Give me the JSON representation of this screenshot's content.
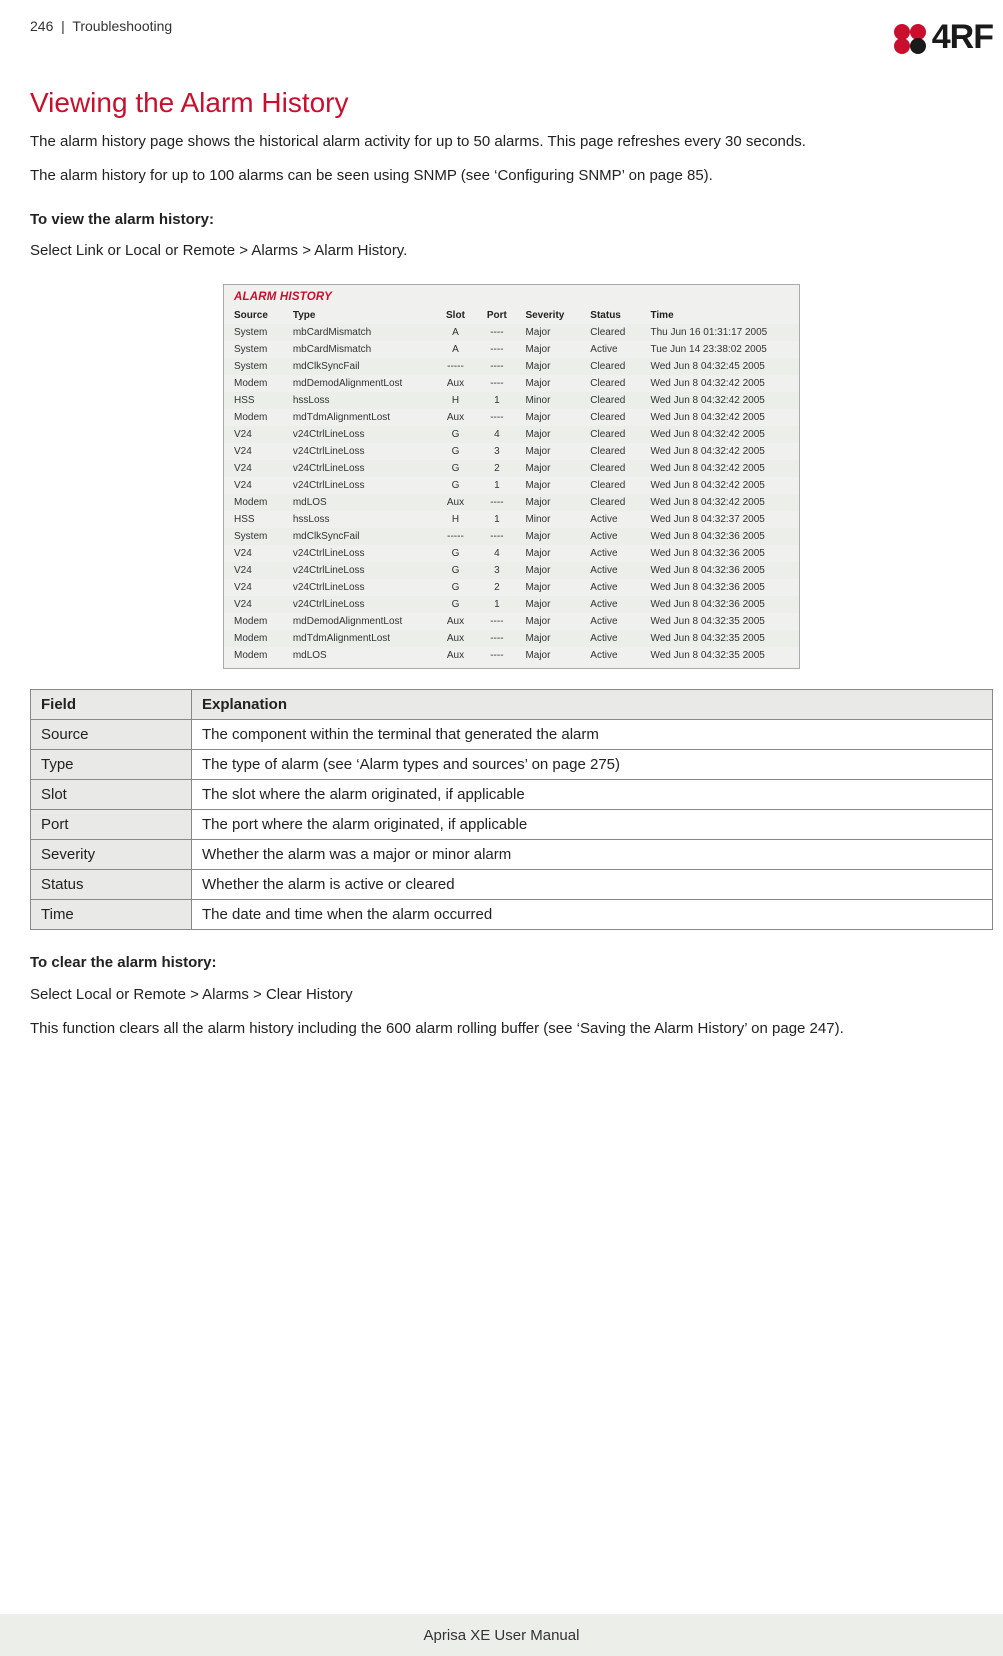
{
  "header": {
    "page_num": "246",
    "pipe": "|",
    "section": "Troubleshooting",
    "logo_text": "4RF"
  },
  "title": "Viewing the Alarm History",
  "intro1": "The alarm history page shows the historical alarm activity for up to 50 alarms. This page refreshes every 30 seconds.",
  "intro2": "The alarm history for up to 100 alarms can be seen using SNMP (see ‘Configuring SNMP’ on page 85).",
  "to_view_heading": "To view the alarm history:",
  "to_view_text": "Select Link or Local or Remote > Alarms > Alarm History.",
  "alarm_history": {
    "title": "ALARM HISTORY",
    "columns": [
      "Source",
      "Type",
      "Slot",
      "Port",
      "Severity",
      "Status",
      "Time"
    ],
    "rows": [
      {
        "source": "System",
        "type": "mbCardMismatch",
        "slot": "A",
        "port": "----",
        "severity": "Major",
        "status": "Cleared",
        "time": "Thu Jun 16 01:31:17 2005"
      },
      {
        "source": "System",
        "type": "mbCardMismatch",
        "slot": "A",
        "port": "----",
        "severity": "Major",
        "status": "Active",
        "time": "Tue Jun 14 23:38:02 2005"
      },
      {
        "source": "System",
        "type": "mdClkSyncFail",
        "slot": "-----",
        "port": "----",
        "severity": "Major",
        "status": "Cleared",
        "time": "Wed Jun 8 04:32:45 2005"
      },
      {
        "source": "Modem",
        "type": "mdDemodAlignmentLost",
        "slot": "Aux",
        "port": "----",
        "severity": "Major",
        "status": "Cleared",
        "time": "Wed Jun 8 04:32:42 2005"
      },
      {
        "source": "HSS",
        "type": "hssLoss",
        "slot": "H",
        "port": "1",
        "severity": "Minor",
        "status": "Cleared",
        "time": "Wed Jun 8 04:32:42 2005"
      },
      {
        "source": "Modem",
        "type": "mdTdmAlignmentLost",
        "slot": "Aux",
        "port": "----",
        "severity": "Major",
        "status": "Cleared",
        "time": "Wed Jun 8 04:32:42 2005"
      },
      {
        "source": "V24",
        "type": "v24CtrlLineLoss",
        "slot": "G",
        "port": "4",
        "severity": "Major",
        "status": "Cleared",
        "time": "Wed Jun 8 04:32:42 2005"
      },
      {
        "source": "V24",
        "type": "v24CtrlLineLoss",
        "slot": "G",
        "port": "3",
        "severity": "Major",
        "status": "Cleared",
        "time": "Wed Jun 8 04:32:42 2005"
      },
      {
        "source": "V24",
        "type": "v24CtrlLineLoss",
        "slot": "G",
        "port": "2",
        "severity": "Major",
        "status": "Cleared",
        "time": "Wed Jun 8 04:32:42 2005"
      },
      {
        "source": "V24",
        "type": "v24CtrlLineLoss",
        "slot": "G",
        "port": "1",
        "severity": "Major",
        "status": "Cleared",
        "time": "Wed Jun 8 04:32:42 2005"
      },
      {
        "source": "Modem",
        "type": "mdLOS",
        "slot": "Aux",
        "port": "----",
        "severity": "Major",
        "status": "Cleared",
        "time": "Wed Jun 8 04:32:42 2005"
      },
      {
        "source": "HSS",
        "type": "hssLoss",
        "slot": "H",
        "port": "1",
        "severity": "Minor",
        "status": "Active",
        "time": "Wed Jun 8 04:32:37 2005"
      },
      {
        "source": "System",
        "type": "mdClkSyncFail",
        "slot": "-----",
        "port": "----",
        "severity": "Major",
        "status": "Active",
        "time": "Wed Jun 8 04:32:36 2005"
      },
      {
        "source": "V24",
        "type": "v24CtrlLineLoss",
        "slot": "G",
        "port": "4",
        "severity": "Major",
        "status": "Active",
        "time": "Wed Jun 8 04:32:36 2005"
      },
      {
        "source": "V24",
        "type": "v24CtrlLineLoss",
        "slot": "G",
        "port": "3",
        "severity": "Major",
        "status": "Active",
        "time": "Wed Jun 8 04:32:36 2005"
      },
      {
        "source": "V24",
        "type": "v24CtrlLineLoss",
        "slot": "G",
        "port": "2",
        "severity": "Major",
        "status": "Active",
        "time": "Wed Jun 8 04:32:36 2005"
      },
      {
        "source": "V24",
        "type": "v24CtrlLineLoss",
        "slot": "G",
        "port": "1",
        "severity": "Major",
        "status": "Active",
        "time": "Wed Jun 8 04:32:36 2005"
      },
      {
        "source": "Modem",
        "type": "mdDemodAlignmentLost",
        "slot": "Aux",
        "port": "----",
        "severity": "Major",
        "status": "Active",
        "time": "Wed Jun 8 04:32:35 2005"
      },
      {
        "source": "Modem",
        "type": "mdTdmAlignmentLost",
        "slot": "Aux",
        "port": "----",
        "severity": "Major",
        "status": "Active",
        "time": "Wed Jun 8 04:32:35 2005"
      },
      {
        "source": "Modem",
        "type": "mdLOS",
        "slot": "Aux",
        "port": "----",
        "severity": "Major",
        "status": "Active",
        "time": "Wed Jun 8 04:32:35 2005"
      }
    ]
  },
  "field_table": {
    "head_field": "Field",
    "head_exp": "Explanation",
    "rows": [
      {
        "field": "Source",
        "exp": "The component within the terminal that generated the alarm"
      },
      {
        "field": "Type",
        "exp": "The type of alarm (see ‘Alarm types and sources’ on page 275)"
      },
      {
        "field": "Slot",
        "exp": "The slot where the alarm originated, if applicable"
      },
      {
        "field": "Port",
        "exp": "The port where the alarm originated, if applicable"
      },
      {
        "field": "Severity",
        "exp": "Whether the alarm was a major or minor alarm"
      },
      {
        "field": "Status",
        "exp": "Whether the alarm is active or cleared"
      },
      {
        "field": "Time",
        "exp": "The date and time when the alarm occurred"
      }
    ]
  },
  "to_clear_heading": "To clear the alarm history:",
  "to_clear_text": "Select Local or Remote > Alarms > Clear History",
  "to_clear_text2": "This function clears all the alarm history including the 600 alarm rolling buffer (see ‘Saving the Alarm History’ on page 247).",
  "footer": "Aprisa XE User Manual"
}
